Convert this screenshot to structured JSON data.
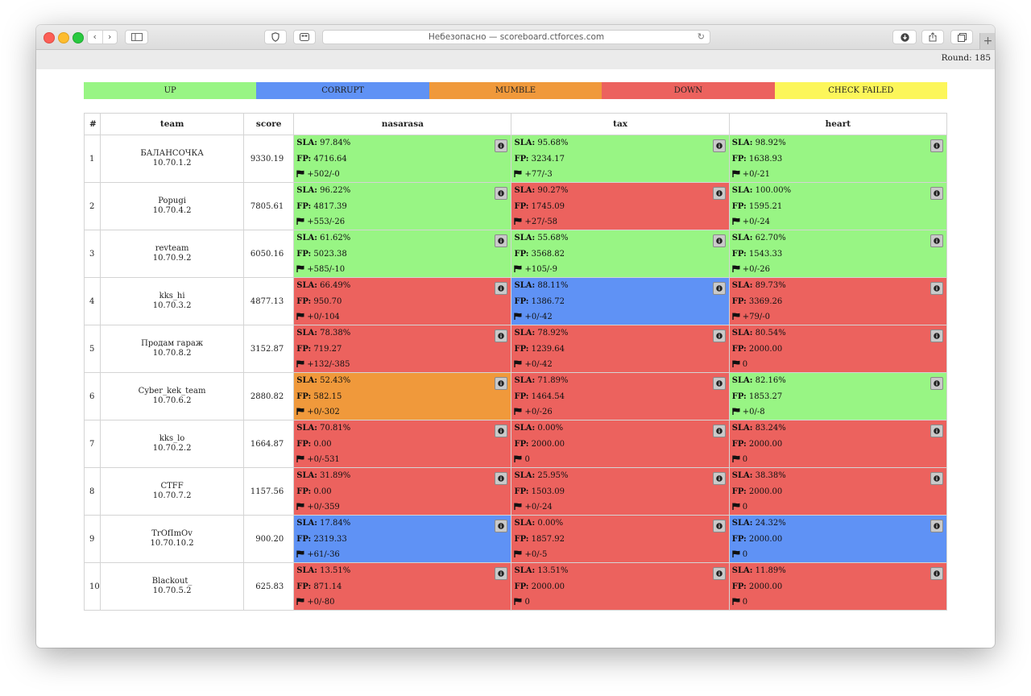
{
  "browser": {
    "address": "Небезопасно — scoreboard.ctforces.com",
    "reload_icon": "↻",
    "back_icon": "‹",
    "forward_icon": "›",
    "new_tab_icon": "+"
  },
  "header": {
    "round_text": "Round: 185"
  },
  "colors": {
    "up": "#98f584",
    "corrupt": "#5f92f5",
    "mumble": "#f0993b",
    "down": "#ec625e",
    "check_failed": "#fcf65a"
  },
  "legend": [
    {
      "label": "UP",
      "status": "up"
    },
    {
      "label": "CORRUPT",
      "status": "corrupt"
    },
    {
      "label": "MUMBLE",
      "status": "mumble"
    },
    {
      "label": "DOWN",
      "status": "down"
    },
    {
      "label": "CHECK FAILED",
      "status": "check_failed"
    }
  ],
  "columns": {
    "num": "#",
    "team": "team",
    "score": "score",
    "services": [
      "nasarasa",
      "tax",
      "heart"
    ]
  },
  "teams": [
    {
      "num": "1",
      "name": "БАЛАНСОЧКА",
      "ip": "10.70.1.2",
      "score": "9330.19",
      "services": [
        {
          "status": "up",
          "sla": "97.84%",
          "fp": "4716.64",
          "flags": "+502/-0"
        },
        {
          "status": "up",
          "sla": "95.68%",
          "fp": "3234.17",
          "flags": "+77/-3"
        },
        {
          "status": "up",
          "sla": "98.92%",
          "fp": "1638.93",
          "flags": "+0/-21"
        }
      ]
    },
    {
      "num": "2",
      "name": "Popugi",
      "ip": "10.70.4.2",
      "score": "7805.61",
      "services": [
        {
          "status": "up",
          "sla": "96.22%",
          "fp": "4817.39",
          "flags": "+553/-26"
        },
        {
          "status": "down",
          "sla": "90.27%",
          "fp": "1745.09",
          "flags": "+27/-58"
        },
        {
          "status": "up",
          "sla": "100.00%",
          "fp": "1595.21",
          "flags": "+0/-24"
        }
      ]
    },
    {
      "num": "3",
      "name": "revteam",
      "ip": "10.70.9.2",
      "score": "6050.16",
      "services": [
        {
          "status": "up",
          "sla": "61.62%",
          "fp": "5023.38",
          "flags": "+585/-10"
        },
        {
          "status": "up",
          "sla": "55.68%",
          "fp": "3568.82",
          "flags": "+105/-9"
        },
        {
          "status": "up",
          "sla": "62.70%",
          "fp": "1543.33",
          "flags": "+0/-26"
        }
      ]
    },
    {
      "num": "4",
      "name": "kks_hi",
      "ip": "10.70.3.2",
      "score": "4877.13",
      "services": [
        {
          "status": "down",
          "sla": "66.49%",
          "fp": "950.70",
          "flags": "+0/-104"
        },
        {
          "status": "corrupt",
          "sla": "88.11%",
          "fp": "1386.72",
          "flags": "+0/-42"
        },
        {
          "status": "down",
          "sla": "89.73%",
          "fp": "3369.26",
          "flags": "+79/-0"
        }
      ]
    },
    {
      "num": "5",
      "name": "Продам гараж",
      "ip": "10.70.8.2",
      "score": "3152.87",
      "services": [
        {
          "status": "down",
          "sla": "78.38%",
          "fp": "719.27",
          "flags": "+132/-385"
        },
        {
          "status": "down",
          "sla": "78.92%",
          "fp": "1239.64",
          "flags": "+0/-42"
        },
        {
          "status": "down",
          "sla": "80.54%",
          "fp": "2000.00",
          "flags": "0"
        }
      ]
    },
    {
      "num": "6",
      "name": "Cyber_kek_team",
      "ip": "10.70.6.2",
      "score": "2880.82",
      "services": [
        {
          "status": "mumble",
          "sla": "52.43%",
          "fp": "582.15",
          "flags": "+0/-302"
        },
        {
          "status": "down",
          "sla": "71.89%",
          "fp": "1464.54",
          "flags": "+0/-26"
        },
        {
          "status": "up",
          "sla": "82.16%",
          "fp": "1853.27",
          "flags": "+0/-8"
        }
      ]
    },
    {
      "num": "7",
      "name": "kks_lo",
      "ip": "10.70.2.2",
      "score": "1664.87",
      "services": [
        {
          "status": "down",
          "sla": "70.81%",
          "fp": "0.00",
          "flags": "+0/-531"
        },
        {
          "status": "down",
          "sla": "0.00%",
          "fp": "2000.00",
          "flags": "0"
        },
        {
          "status": "down",
          "sla": "83.24%",
          "fp": "2000.00",
          "flags": "0"
        }
      ]
    },
    {
      "num": "8",
      "name": "CTFF",
      "ip": "10.70.7.2",
      "score": "1157.56",
      "services": [
        {
          "status": "down",
          "sla": "31.89%",
          "fp": "0.00",
          "flags": "+0/-359"
        },
        {
          "status": "down",
          "sla": "25.95%",
          "fp": "1503.09",
          "flags": "+0/-24"
        },
        {
          "status": "down",
          "sla": "38.38%",
          "fp": "2000.00",
          "flags": "0"
        }
      ]
    },
    {
      "num": "9",
      "name": "TrOfImOv",
      "ip": "10.70.10.2",
      "score": "900.20",
      "services": [
        {
          "status": "corrupt",
          "sla": "17.84%",
          "fp": "2319.33",
          "flags": "+61/-36"
        },
        {
          "status": "down",
          "sla": "0.00%",
          "fp": "1857.92",
          "flags": "+0/-5"
        },
        {
          "status": "corrupt",
          "sla": "24.32%",
          "fp": "2000.00",
          "flags": "0"
        }
      ]
    },
    {
      "num": "10",
      "name": "Blackout_",
      "ip": "10.70.5.2",
      "score": "625.83",
      "services": [
        {
          "status": "down",
          "sla": "13.51%",
          "fp": "871.14",
          "flags": "+0/-80"
        },
        {
          "status": "down",
          "sla": "13.51%",
          "fp": "2000.00",
          "flags": "0"
        },
        {
          "status": "down",
          "sla": "11.89%",
          "fp": "2000.00",
          "flags": "0"
        }
      ]
    }
  ],
  "labels": {
    "sla": "SLA:",
    "fp": "FP:"
  },
  "icons": {
    "flag": "flag-icon",
    "info": "info-icon"
  }
}
